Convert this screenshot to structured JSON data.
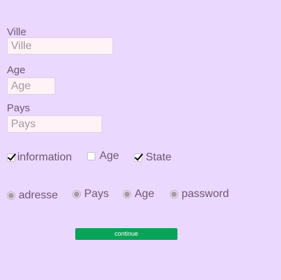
{
  "form": {
    "fields": [
      {
        "label": "Ville",
        "placeholder": "Ville",
        "value": ""
      },
      {
        "label": "Age",
        "placeholder": "Age",
        "value": ""
      },
      {
        "label": "Pays",
        "placeholder": "Pays",
        "value": ""
      }
    ],
    "checkboxes": [
      {
        "label": "information",
        "checked": true
      },
      {
        "label": "Age",
        "checked": false
      },
      {
        "label": "State",
        "checked": true
      }
    ],
    "radios": [
      {
        "label": "adresse"
      },
      {
        "label": "Pays"
      },
      {
        "label": "Age"
      },
      {
        "label": "password"
      }
    ],
    "continue_label": "continue"
  },
  "colors": {
    "background": "#ead8ff",
    "text": "#6f5670",
    "input_background": "#fff3f7",
    "button": "#0aa358",
    "button_text": "#ffffff"
  }
}
